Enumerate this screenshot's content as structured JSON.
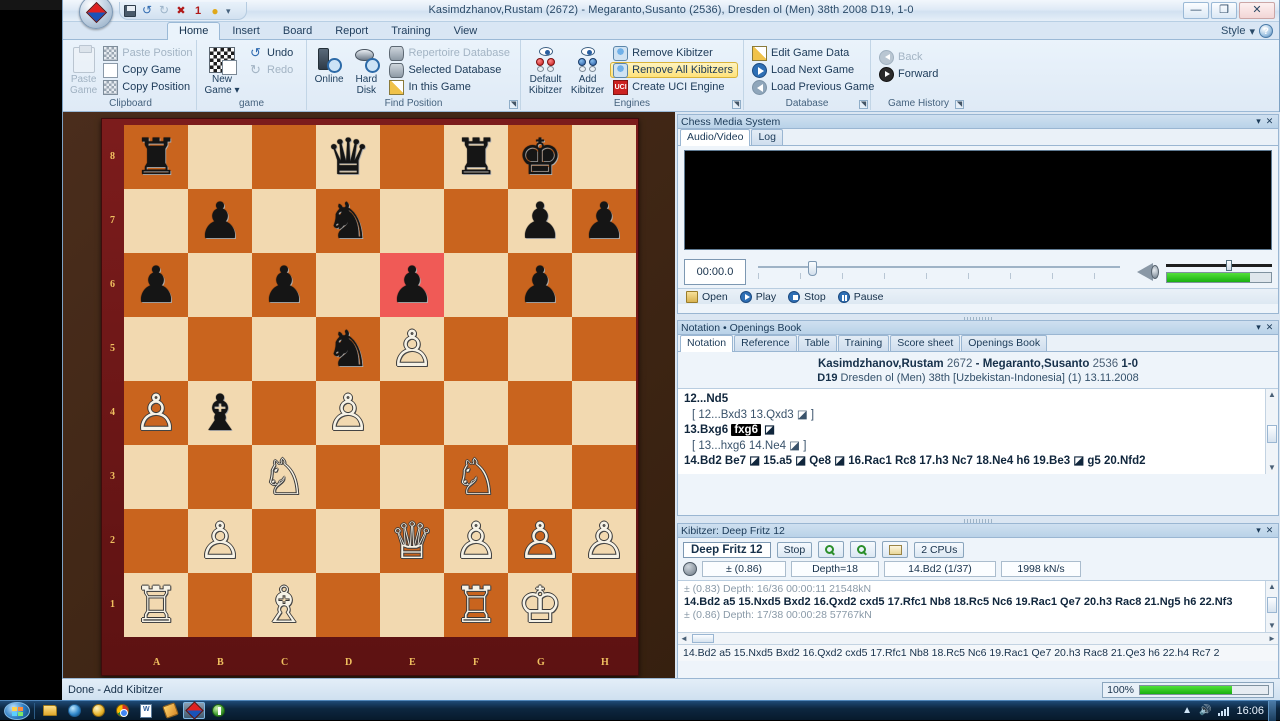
{
  "window": {
    "title": "Kasimdzhanov,Rustam (2672) - Megaranto,Susanto (2536), Dresden ol (Men) 38th 2008  D19, 1-0",
    "minimize": "—",
    "restore": "❐",
    "close": "✕"
  },
  "quick_access": {
    "items": [
      {
        "name": "save-icon",
        "glyph": ""
      },
      {
        "name": "undo-icon",
        "glyph": "↺"
      },
      {
        "name": "redo-icon",
        "glyph": "↻"
      },
      {
        "name": "bug-icon",
        "glyph": "✖"
      },
      {
        "name": "one-icon",
        "glyph": "1"
      },
      {
        "name": "bulb-icon",
        "glyph": "●"
      },
      {
        "name": "customize-icon",
        "glyph": "▾"
      }
    ]
  },
  "ribbon": {
    "tabs": [
      {
        "label": "Home",
        "active": true
      },
      {
        "label": "Insert",
        "active": false
      },
      {
        "label": "Board",
        "active": false
      },
      {
        "label": "Report",
        "active": false
      },
      {
        "label": "Training",
        "active": false
      },
      {
        "label": "View",
        "active": false
      }
    ],
    "style_menu": {
      "label": "Style",
      "caret": "▾",
      "help": "?"
    },
    "groups": [
      {
        "title": "Clipboard",
        "big": [
          {
            "label": "Paste\nGame",
            "icon": "paste-icon",
            "disabled": true
          }
        ],
        "small": [
          {
            "label": "Paste Position",
            "icon": "paste-position-icon",
            "disabled": true
          },
          {
            "label": "Copy Game",
            "icon": "copy-game-icon",
            "disabled": false
          },
          {
            "label": "Copy Position",
            "icon": "copy-position-icon",
            "disabled": false
          }
        ]
      },
      {
        "title": "game",
        "big": [
          {
            "label": "New\nGame ▾",
            "icon": "new-game-icon",
            "disabled": false
          }
        ],
        "small": [
          {
            "label": "Undo",
            "icon": "undo-icon",
            "disabled": false
          },
          {
            "label": "Redo",
            "icon": "redo-icon",
            "disabled": true
          }
        ]
      },
      {
        "title": "Find Position",
        "big": [
          {
            "label": "Online",
            "icon": "online-search-icon",
            "disabled": false
          },
          {
            "label": "Hard\nDisk",
            "icon": "hard-disk-search-icon",
            "disabled": false
          }
        ],
        "small": [
          {
            "label": "Repertoire Database",
            "icon": "repertoire-database-icon",
            "disabled": true
          },
          {
            "label": "Selected Database",
            "icon": "selected-database-icon",
            "disabled": false
          },
          {
            "label": "In this Game",
            "icon": "in-this-game-icon",
            "disabled": false
          }
        ]
      },
      {
        "title": "Engines",
        "big": [
          {
            "label": "Default\nKibitzer",
            "icon": "default-kibitzer-icon",
            "disabled": false
          },
          {
            "label": "Add\nKibitzer",
            "icon": "add-kibitzer-icon",
            "disabled": false
          }
        ],
        "small": [
          {
            "label": "Remove Kibitzer",
            "icon": "remove-kibitzer-icon",
            "disabled": false,
            "highlighted": false
          },
          {
            "label": "Remove All Kibitzers",
            "icon": "remove-all-kibitzers-icon",
            "disabled": false,
            "highlighted": true
          },
          {
            "label": "Create UCI Engine",
            "icon": "create-uci-engine-icon",
            "disabled": false,
            "highlighted": false
          }
        ]
      },
      {
        "title": "Database",
        "small": [
          {
            "label": "Edit Game Data",
            "icon": "edit-game-data-icon",
            "disabled": false
          },
          {
            "label": "Load Next Game",
            "icon": "load-next-game-icon",
            "disabled": false
          },
          {
            "label": "Load Previous Game",
            "icon": "load-previous-game-icon",
            "disabled": false
          }
        ]
      },
      {
        "title": "Game History",
        "small": [
          {
            "label": "Back",
            "icon": "back-icon",
            "disabled": true
          },
          {
            "label": "Forward",
            "icon": "forward-icon",
            "disabled": false
          }
        ]
      }
    ]
  },
  "board": {
    "files": [
      "A",
      "B",
      "C",
      "D",
      "E",
      "F",
      "G",
      "H"
    ],
    "ranks": [
      "8",
      "7",
      "6",
      "5",
      "4",
      "3",
      "2",
      "1"
    ],
    "highlight_square": "e6",
    "pieces": [
      {
        "sq": "a8",
        "piece": "♜",
        "color": "b"
      },
      {
        "sq": "d8",
        "piece": "♛",
        "color": "b"
      },
      {
        "sq": "f8",
        "piece": "♜",
        "color": "b"
      },
      {
        "sq": "g8",
        "piece": "♚",
        "color": "b"
      },
      {
        "sq": "b7",
        "piece": "♟",
        "color": "b"
      },
      {
        "sq": "d7",
        "piece": "♞",
        "color": "b"
      },
      {
        "sq": "g7",
        "piece": "♟",
        "color": "b"
      },
      {
        "sq": "h7",
        "piece": "♟",
        "color": "b"
      },
      {
        "sq": "a6",
        "piece": "♟",
        "color": "b"
      },
      {
        "sq": "c6",
        "piece": "♟",
        "color": "b"
      },
      {
        "sq": "e6",
        "piece": "♟",
        "color": "b"
      },
      {
        "sq": "g6",
        "piece": "♟",
        "color": "b"
      },
      {
        "sq": "d5",
        "piece": "♞",
        "color": "b"
      },
      {
        "sq": "e5",
        "piece": "♙",
        "color": "w"
      },
      {
        "sq": "a4",
        "piece": "♙",
        "color": "w"
      },
      {
        "sq": "b4",
        "piece": "♝",
        "color": "b"
      },
      {
        "sq": "d4",
        "piece": "♙",
        "color": "w"
      },
      {
        "sq": "c3",
        "piece": "♘",
        "color": "w"
      },
      {
        "sq": "f3",
        "piece": "♘",
        "color": "w"
      },
      {
        "sq": "b2",
        "piece": "♙",
        "color": "w"
      },
      {
        "sq": "e2",
        "piece": "♕",
        "color": "w"
      },
      {
        "sq": "f2",
        "piece": "♙",
        "color": "w"
      },
      {
        "sq": "g2",
        "piece": "♙",
        "color": "w"
      },
      {
        "sq": "h2",
        "piece": "♙",
        "color": "w"
      },
      {
        "sq": "a1",
        "piece": "♖",
        "color": "w"
      },
      {
        "sq": "c1",
        "piece": "♗",
        "color": "w"
      },
      {
        "sq": "f1",
        "piece": "♖",
        "color": "w"
      },
      {
        "sq": "g1",
        "piece": "♔",
        "color": "w"
      }
    ]
  },
  "media_panel": {
    "caption": "Chess Media System",
    "collapse": "▾",
    "close": "✕",
    "tabs": [
      {
        "label": "Audio/Video",
        "active": true
      },
      {
        "label": "Log",
        "active": false
      }
    ],
    "time": "00:00.0",
    "buttons": [
      {
        "label": "Open",
        "icon": "open-icon"
      },
      {
        "label": "Play",
        "icon": "play-icon"
      },
      {
        "label": "Stop",
        "icon": "stop-icon"
      },
      {
        "label": "Pause",
        "icon": "pause-icon"
      }
    ]
  },
  "notation_panel": {
    "caption": "Notation • Openings Book",
    "collapse": "▾",
    "close": "✕",
    "tabs": [
      {
        "label": "Notation",
        "active": true
      },
      {
        "label": "Reference",
        "active": false
      },
      {
        "label": "Table",
        "active": false
      },
      {
        "label": "Training",
        "active": false
      },
      {
        "label": "Score sheet",
        "active": false
      },
      {
        "label": "Openings Book",
        "active": false
      }
    ],
    "header": {
      "white": "Kasimdzhanov,Rustam",
      "white_elo": "2672",
      "dash": "-",
      "black": "Megaranto,Susanto",
      "black_elo": "2536",
      "result": "1-0",
      "eco": "D19",
      "event": "Dresden ol (Men) 38th [Uzbekistan-Indonesia] (1) 13.11.2008"
    },
    "lines": [
      {
        "kind": "main",
        "text": "12...Nd5"
      },
      {
        "kind": "var",
        "text": "[ 12...Bxd3  13.Qxd3  ◪ ]"
      },
      {
        "kind": "main-current",
        "prefix": "13.Bxg6 ",
        "current": "fxg6",
        "suffix": " ◪"
      },
      {
        "kind": "var",
        "text": "[ 13...hxg6  14.Ne4  ◪ ]"
      },
      {
        "kind": "main",
        "text": "14.Bd2  Be7 ◪  15.a5 ◪  Qe8 ◪  16.Rac1  Rc8  17.h3  Nc7  18.Ne4  h6  19.Be3 ◪  g5  20.Nfd2"
      }
    ],
    "scroll_up": "▲",
    "scroll_down": "▼"
  },
  "kibitzer_panel": {
    "caption": "Kibitzer: Deep Fritz 12",
    "collapse": "▾",
    "close": "✕",
    "engine_name": "Deep Fritz 12",
    "stop_label": "Stop",
    "cpus": "2 CPUs",
    "buttons": [
      {
        "name": "zoom-in-icon"
      },
      {
        "name": "zoom-out-icon"
      },
      {
        "name": "edit-icon"
      }
    ],
    "fields": {
      "score": "± (0.86)",
      "depth": "Depth=18",
      "move": "14.Bd2 (1/37)",
      "speed": "1998 kN/s"
    },
    "analysis": [
      {
        "kind": "info",
        "text": "±  (0.83)   Depth: 16/36   00:00:11  21548kN"
      },
      {
        "kind": "pv",
        "text": "14.Bd2 a5 15.Nxd5 Bxd2 16.Qxd2 cxd5 17.Rfc1 Nb8 18.Rc5 Nc6 19.Rac1 Qe7 20.h3 Rac8 21.Ng5 h6 22.Nf3"
      },
      {
        "kind": "info",
        "text": "±  (0.86)   Depth: 17/38   00:00:28  57767kN"
      }
    ],
    "footer": "14.Bd2 a5 15.Nxd5 Bxd2 16.Qxd2 cxd5 17.Rfc1 Nb8 18.Rc5 Nc6 19.Rac1 Qe7 20.h3 Rac8 21.Qe3 h6 22.h4 Rc7 2",
    "scroll_up": "▲",
    "scroll_down": "▼",
    "scroll_left": "◄",
    "scroll_right": "►"
  },
  "status_bar": {
    "message": "Done - Add Kibitzer",
    "zoom_percent": "100%"
  },
  "taskbar": {
    "items": [
      {
        "name": "explorer-icon",
        "active": false
      },
      {
        "name": "internet-explorer-icon",
        "active": false
      },
      {
        "name": "media-player-icon",
        "active": false
      },
      {
        "name": "chrome-icon",
        "active": false
      },
      {
        "name": "word-icon",
        "active": false
      },
      {
        "name": "paint-icon",
        "active": false
      },
      {
        "name": "chessbase-icon",
        "active": true
      },
      {
        "name": "utility-icon",
        "active": false
      }
    ],
    "clock": "16:06",
    "tray_expand": "▲"
  }
}
